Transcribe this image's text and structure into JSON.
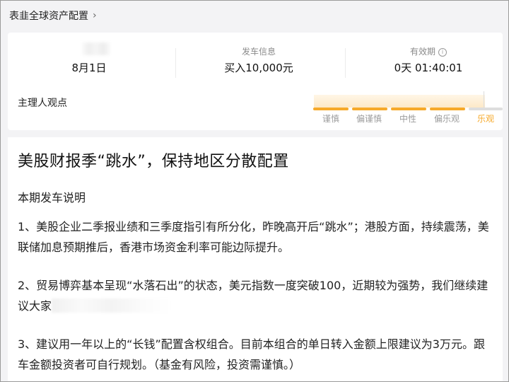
{
  "topbar": {
    "title": "表韭全球资产配置",
    "chevron_icon": "chevron-right-icon"
  },
  "summary": {
    "date": {
      "label": "",
      "value": "8月1日"
    },
    "trade": {
      "label": "发车信息",
      "value": "买入10,000元"
    },
    "validity": {
      "label": "有效期",
      "value": "0天 01:40:01",
      "info_icon": "info-icon"
    }
  },
  "opinion": {
    "label": "主理人观点",
    "scale": [
      "谨慎",
      "偏谨慎",
      "中性",
      "偏乐观",
      "乐观"
    ],
    "selected": "乐观",
    "accent_color": "#f6a92a"
  },
  "article": {
    "headline": "美股财报季“跳水”，保持地区分散配置",
    "subhead": "本期发车说明",
    "p1": "1、美股企业二季报业绩和三季度指引有所分化，昨晚高开后“跳水”；港股方面，持续震荡，美联储加息预期推后，香港市场资金利率可能边际提升。",
    "p2": "2、贸易博弈基本呈现“水落石出”的状态，美元指数一度突破100，近期较为强势，我们继续建议大家",
    "p3": "3、建议用一年以上的“长钱”配置含权组合。目前本组合的单日转入金额上限建议为3万元。跟车金额投资者可自行规划。（基金有风险，投资需谨慎。）"
  }
}
